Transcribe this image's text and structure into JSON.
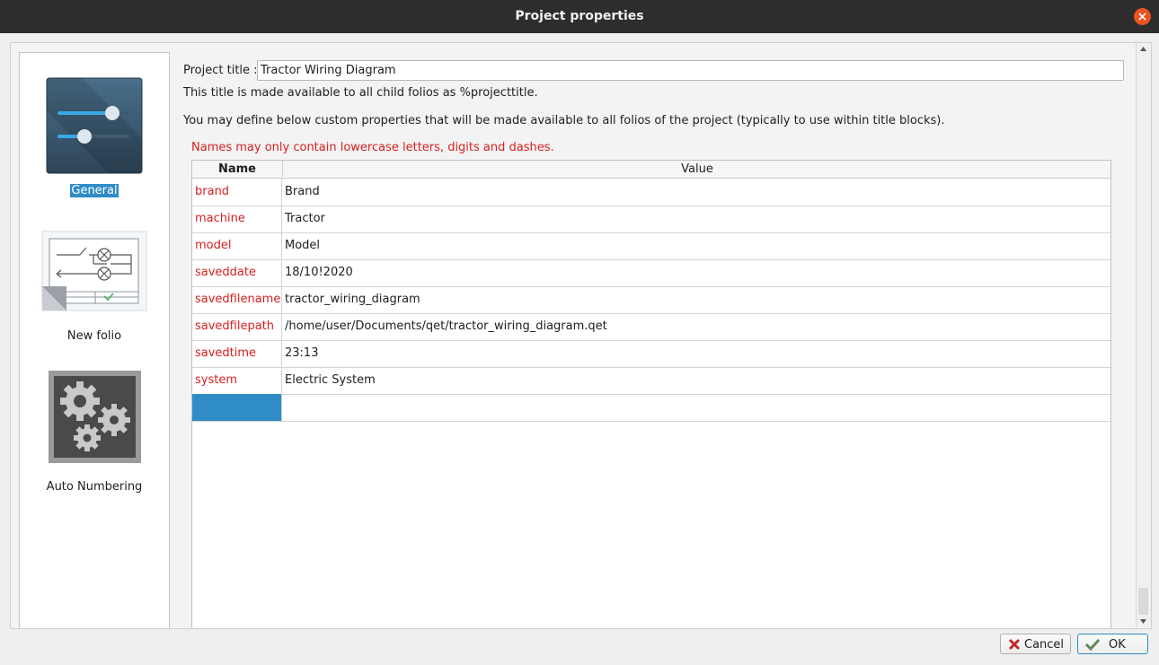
{
  "window": {
    "title": "Project properties"
  },
  "nav": {
    "items": [
      {
        "label": "General",
        "icon": "sliders-icon",
        "selected": true
      },
      {
        "label": "New folio",
        "icon": "folio-schematic-icon",
        "selected": false
      },
      {
        "label": "Auto Numbering",
        "icon": "gears-icon",
        "selected": false
      }
    ]
  },
  "general": {
    "project_title_label": "Project title :",
    "project_title_value": "Tractor Wiring Diagram",
    "title_hint": "This title is made available to all child folios as %projecttitle.",
    "custom_hint": "You may define below custom properties that will be made available to all folios of the project (typically to use within title blocks).",
    "names_warning": "Names may only contain lowercase letters, digits and dashes."
  },
  "properties_table": {
    "headers": {
      "name": "Name",
      "value": "Value"
    },
    "rows": [
      {
        "name": "brand",
        "value": "Brand"
      },
      {
        "name": "machine",
        "value": "Tractor"
      },
      {
        "name": "model",
        "value": "Model"
      },
      {
        "name": "saveddate",
        "value": "18/10!2020"
      },
      {
        "name": "savedfilename",
        "value": "tractor_wiring_diagram"
      },
      {
        "name": "savedfilepath",
        "value": "/home/user/Documents/qet/tractor_wiring_diagram.qet"
      },
      {
        "name": "savedtime",
        "value": "23:13"
      },
      {
        "name": "system",
        "value": "Electric System"
      }
    ]
  },
  "buttons": {
    "cancel": "Cancel",
    "ok": "OK"
  },
  "colors": {
    "accent": "#308cc6",
    "warning": "#d82020",
    "titlebar": "#2d2d2d",
    "close": "#e95420"
  }
}
